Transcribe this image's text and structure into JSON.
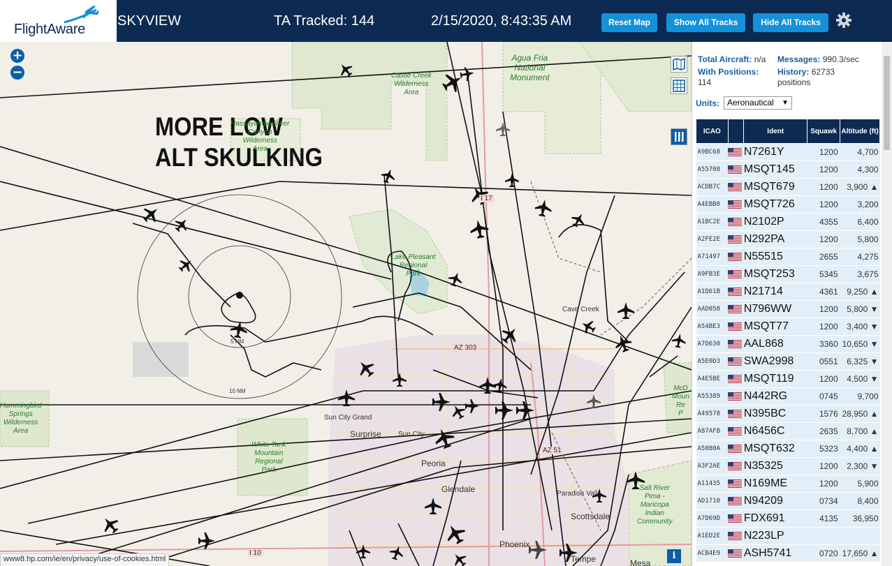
{
  "header": {
    "logo_text": "FlightAware",
    "app_name": "SKYVIEW",
    "tracked": "TA Tracked: 144",
    "datetime": "2/15/2020, 8:43:35 AM",
    "buttons": {
      "reset": "Reset Map",
      "show": "Show All Tracks",
      "hide": "Hide All Tracks"
    },
    "settings_icon": "gear-icon"
  },
  "map": {
    "overlay_text_line1": "MORE LOW",
    "overlay_text_line2": "ALT SKULKING",
    "zoom_in": "+",
    "zoom_out": "−",
    "places": {
      "cave_creek": "Cave Creek",
      "sun_city_grand": "Sun City Grand",
      "sun_city": "Sun City",
      "surprise": "Surprise",
      "peoria": "Peoria",
      "glendale": "Glendale",
      "scottsdale": "Scottsdale",
      "paradise_valley": "Paradise Vall",
      "phoenix": "Phoenix",
      "tempe": "Tempe",
      "mesa": "Mesa",
      "az303": "AZ 303",
      "az51": "AZ 51",
      "i10": "I 10",
      "i17": "I 17",
      "ring5": "5 NM",
      "ring10": "10 NM"
    },
    "parks": {
      "castle_creek": [
        "Castle Creek",
        "Wilderness",
        "Area"
      ],
      "agua_fria": [
        "Agua Fria",
        "National",
        "Monument"
      ],
      "hassayampa": [
        "Hassayampa River",
        "Canyon",
        "Wilderness",
        "Area"
      ],
      "lake_pleasant": [
        "Lake Pleasant",
        "Regional",
        "Park"
      ],
      "white_tank": [
        "White Tank",
        "Mountain",
        "Regional",
        "Park"
      ],
      "hummingbird": [
        "Hummingbird",
        "Springs",
        "Wilderness",
        "Area"
      ],
      "salt_river": [
        "Salt River",
        "Pima -",
        "Maricopa",
        "Indian",
        "Community"
      ],
      "mcdowell": [
        "McD",
        "Moun",
        "Re",
        "P"
      ]
    },
    "status_url": "www8.hp.com/ie/en/privacy/use-of-cookies.html",
    "info_button": "i"
  },
  "panel": {
    "total_aircraft_label": "Total Aircraft:",
    "total_aircraft_value": "n/a",
    "with_positions_label": "With Positions:",
    "with_positions_value": "114",
    "messages_label": "Messages:",
    "messages_value": "990.3/sec",
    "history_label": "History:",
    "history_value": "62733",
    "history_unit": "positions",
    "units_label": "Units:",
    "units_value": "Aeronautical",
    "columns": [
      "ICAO",
      "",
      "Ident",
      "Squawk",
      "Altitude (ft)"
    ],
    "rows": [
      {
        "icao": "A9BC68",
        "ident": "N7261Y",
        "squawk": "1200",
        "alt": "4,700"
      },
      {
        "icao": "A55708",
        "ident": "MSQT145",
        "squawk": "1200",
        "alt": "4,300"
      },
      {
        "icao": "ACDB7C",
        "ident": "MSQT679",
        "squawk": "1200",
        "alt": "3,900 ▲"
      },
      {
        "icao": "A4EBB0",
        "ident": "MSQT726",
        "squawk": "1200",
        "alt": "3,200"
      },
      {
        "icao": "A1BC2E",
        "ident": "N2102P",
        "squawk": "4355",
        "alt": "6,400"
      },
      {
        "icao": "A2FE2E",
        "ident": "N292PA",
        "squawk": "1200",
        "alt": "5,800"
      },
      {
        "icao": "A71497",
        "ident": "N55515",
        "squawk": "2655",
        "alt": "4,275"
      },
      {
        "icao": "A9FB3E",
        "ident": "MSQT253",
        "squawk": "5345",
        "alt": "3,675"
      },
      {
        "icao": "A1D61B",
        "ident": "N21714",
        "squawk": "4361",
        "alt": "9,250 ▲"
      },
      {
        "icao": "AAD058",
        "ident": "N796WW",
        "squawk": "1200",
        "alt": "5,800 ▼"
      },
      {
        "icao": "A54BE3",
        "ident": "MSQT77",
        "squawk": "1200",
        "alt": "3,400 ▼"
      },
      {
        "icao": "A7D630",
        "ident": "AAL868",
        "squawk": "3360",
        "alt": "10,650 ▼"
      },
      {
        "icao": "A5E0D3",
        "ident": "SWA2998",
        "squawk": "0551",
        "alt": "6,325 ▼"
      },
      {
        "icao": "A4E5BE",
        "ident": "MSQT119",
        "squawk": "1200",
        "alt": "4,500 ▼"
      },
      {
        "icao": "A55389",
        "ident": "N442RG",
        "squawk": "0745",
        "alt": "9,700"
      },
      {
        "icao": "A49578",
        "ident": "N395BC",
        "squawk": "1576",
        "alt": "28,950 ▲"
      },
      {
        "icao": "A87AFB",
        "ident": "N6456C",
        "squawk": "2635",
        "alt": "8,700 ▲"
      },
      {
        "icao": "A5080A",
        "ident": "MSQT632",
        "squawk": "5323",
        "alt": "4,400 ▲"
      },
      {
        "icao": "A3F2AE",
        "ident": "N35325",
        "squawk": "1200",
        "alt": "2,300 ▼"
      },
      {
        "icao": "A11435",
        "ident": "N169ME",
        "squawk": "1200",
        "alt": "5,900"
      },
      {
        "icao": "AD1710",
        "ident": "N94209",
        "squawk": "0734",
        "alt": "8,400"
      },
      {
        "icao": "A7D69D",
        "ident": "FDX691",
        "squawk": "4135",
        "alt": "36,950"
      },
      {
        "icao": "A1ED2E",
        "ident": "N223LP",
        "squawk": "",
        "alt": ""
      },
      {
        "icao": "ACB4E9",
        "ident": "ASH5741",
        "squawk": "0720",
        "alt": "17,650 ▲"
      }
    ]
  },
  "colors": {
    "header_bg": "#0c2a52",
    "button_bg": "#1391d9",
    "row_bg": "#e3eff8",
    "accent": "#1a5fa0"
  }
}
